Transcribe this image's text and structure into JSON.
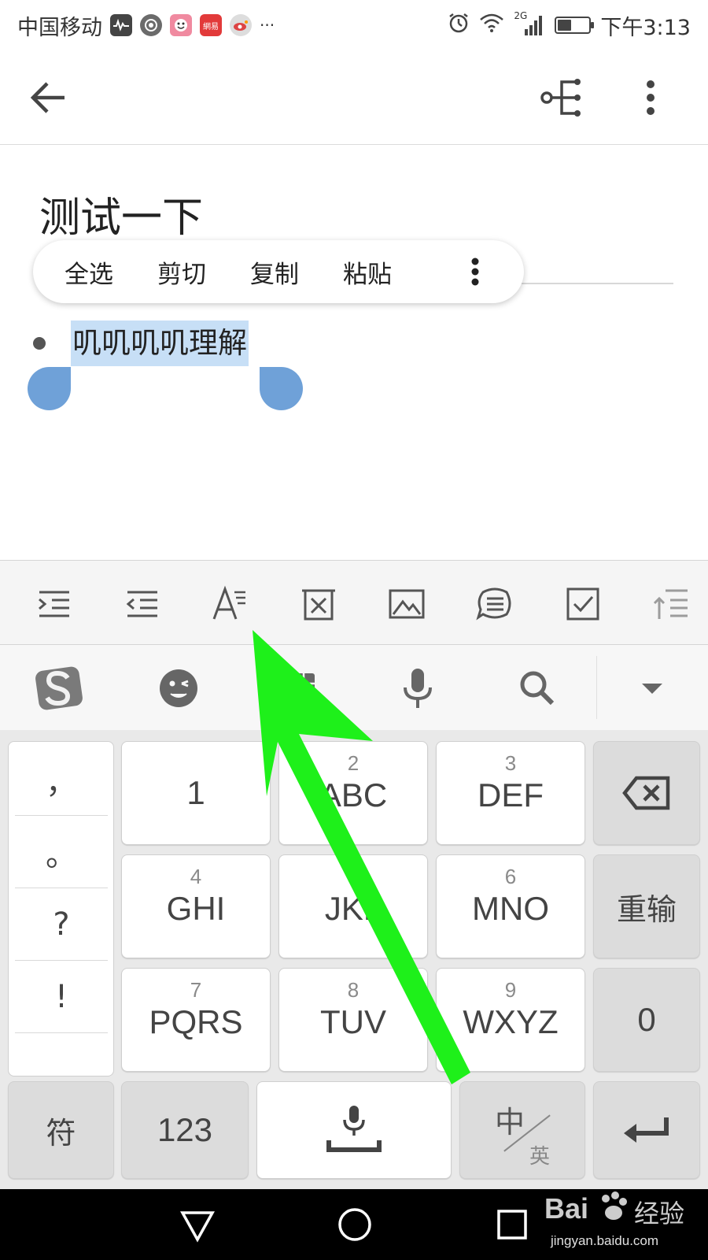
{
  "status_bar": {
    "carrier": "中国移动",
    "more_indicator": "···",
    "network_label": "2G",
    "time": "下午3:13",
    "battery_level_fraction": 0.45,
    "app_icons": [
      "activity-icon",
      "camera-app-icon",
      "smiley-app-icon",
      "netease-news-icon",
      "weibo-icon"
    ],
    "netease_label": "網易"
  },
  "app_bar": {
    "icons": [
      "back-arrow-icon",
      "share-tree-icon",
      "more-vert-icon"
    ]
  },
  "note": {
    "title": "测试一下",
    "bullet_text": "叽叽叽叽理解"
  },
  "context_menu": {
    "items": [
      "全选",
      "剪切",
      "复制",
      "粘贴"
    ],
    "more_icon": "more-vert-icon"
  },
  "format_toolbar": {
    "icons": [
      "indent-icon",
      "outdent-icon",
      "text-format-icon",
      "delete-box-icon",
      "image-icon",
      "chat-list-icon",
      "checkbox-icon",
      "line-spacing-icon"
    ]
  },
  "ime_toolbar": {
    "icons": [
      "sogou-logo-icon",
      "emoji-wink-icon",
      "keyboard-grid-icon",
      "microphone-icon",
      "search-icon",
      "collapse-down-icon"
    ]
  },
  "keyboard": {
    "punctuation": [
      "，",
      "。",
      "?",
      "!"
    ],
    "rows": [
      [
        {
          "num": "",
          "letters": "1"
        },
        {
          "num": "2",
          "letters": "ABC"
        },
        {
          "num": "3",
          "letters": "DEF"
        }
      ],
      [
        {
          "num": "4",
          "letters": "GHI"
        },
        {
          "num": "5",
          "letters": "JKL"
        },
        {
          "num": "6",
          "letters": "MNO"
        }
      ],
      [
        {
          "num": "7",
          "letters": "PQRS"
        },
        {
          "num": "8",
          "letters": "TUV"
        },
        {
          "num": "9",
          "letters": "WXYZ"
        }
      ]
    ],
    "right_column": {
      "backspace_icon": "backspace-icon",
      "reinput": "重输",
      "zero": "0"
    },
    "bottom_row": {
      "symbols": "符",
      "numbers": "123",
      "space_icon": "mic-space-icon",
      "lang_top": "中",
      "lang_bottom": "英",
      "enter_icon": "enter-icon"
    }
  },
  "nav_bar": {
    "icons": [
      "nav-back-triangle-icon",
      "nav-home-circle-icon",
      "nav-recents-square-icon"
    ]
  },
  "watermark": {
    "text": "jingyan.baidu.com",
    "logo_text": "Bai",
    "logo_suffix": "经验"
  },
  "annotation": {
    "color": "#1ef01a",
    "icon": "green-pointer-arrow"
  }
}
